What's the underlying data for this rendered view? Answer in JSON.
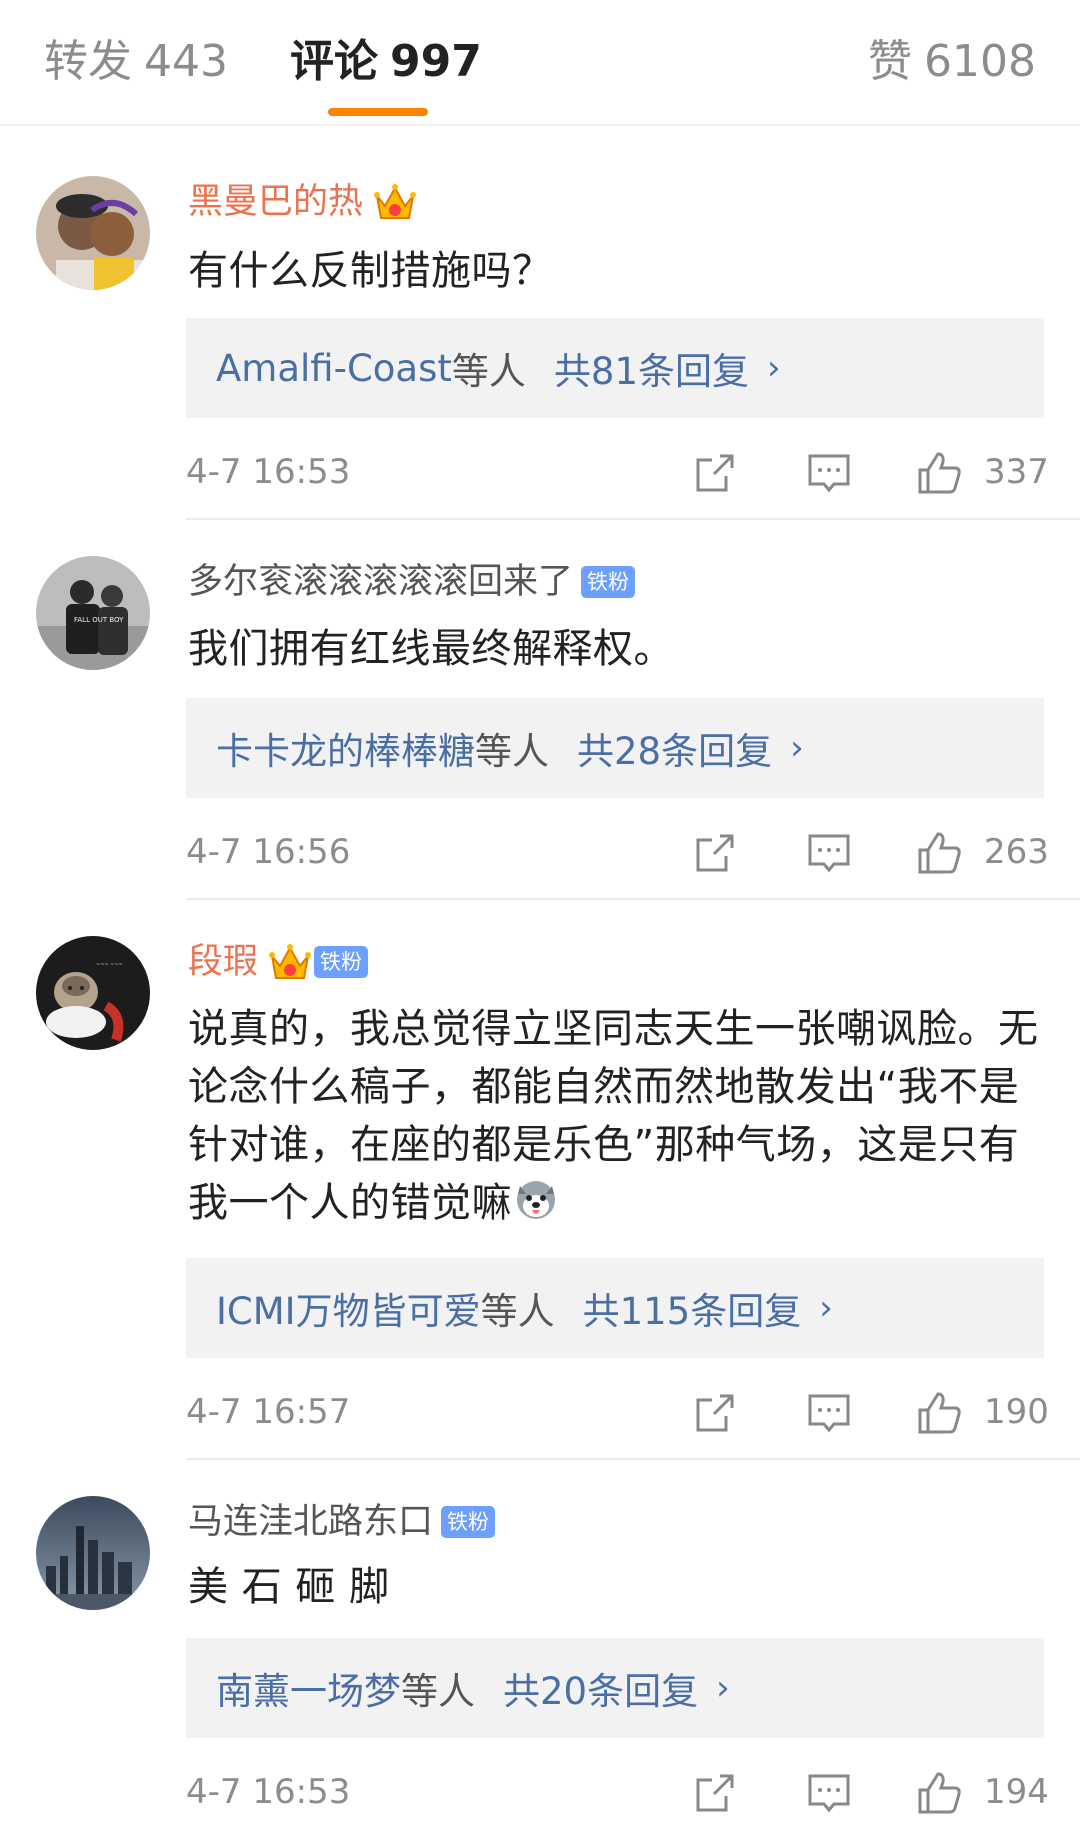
{
  "tabs": {
    "repost": {
      "label": "转发",
      "count": "443"
    },
    "comments": {
      "label": "评论",
      "count": "997"
    },
    "likes": {
      "label": "赞",
      "count": "6108"
    }
  },
  "colors": {
    "accent": "#ff8200",
    "vip_name": "#eb7350",
    "link": "#4a6fa5",
    "badge": "#6d9fff"
  },
  "comments": [
    {
      "username": "黑曼巴的热",
      "vip": true,
      "badge": "",
      "text": "有什么反制措施吗？",
      "replies": {
        "names": "Amalfi-Coast",
        "etc": "等人",
        "total": "共81条回复"
      },
      "time": "4-7 16:53",
      "likes": "337"
    },
    {
      "username": "多尔衮滚滚滚滚滚回来了",
      "vip": false,
      "badge": "铁粉",
      "text": "我们拥有红线最终解释权。",
      "replies": {
        "names": "卡卡龙的棒棒糖",
        "etc": "等人",
        "total": "共28条回复"
      },
      "time": "4-7 16:56",
      "likes": "263"
    },
    {
      "username": "段瑕",
      "vip": true,
      "badge": "铁粉",
      "text": "说真的，我总觉得立坚同志天生一张嘲讽脸。无论念什么稿子，都能自然而然地散发出“我不是针对谁，在座的都是乐色”那种气场，这是只有我一个人的错觉嘛",
      "replies": {
        "names": "ICMI万物皆可爱",
        "etc": "等人",
        "total": "共115条回复"
      },
      "time": "4-7 16:57",
      "likes": "190"
    },
    {
      "username": "马连洼北路东口",
      "vip": false,
      "badge": "铁粉",
      "text": "美 石 砸 脚",
      "replies": {
        "names": "南薰一场梦",
        "etc": "等人",
        "total": "共20条回复"
      },
      "time": "4-7 16:53",
      "likes": "194"
    }
  ],
  "icons": {
    "share": "share-icon",
    "comment": "comment-icon",
    "like": "thumbs-up-icon",
    "chevron": "chevron-right-icon"
  }
}
